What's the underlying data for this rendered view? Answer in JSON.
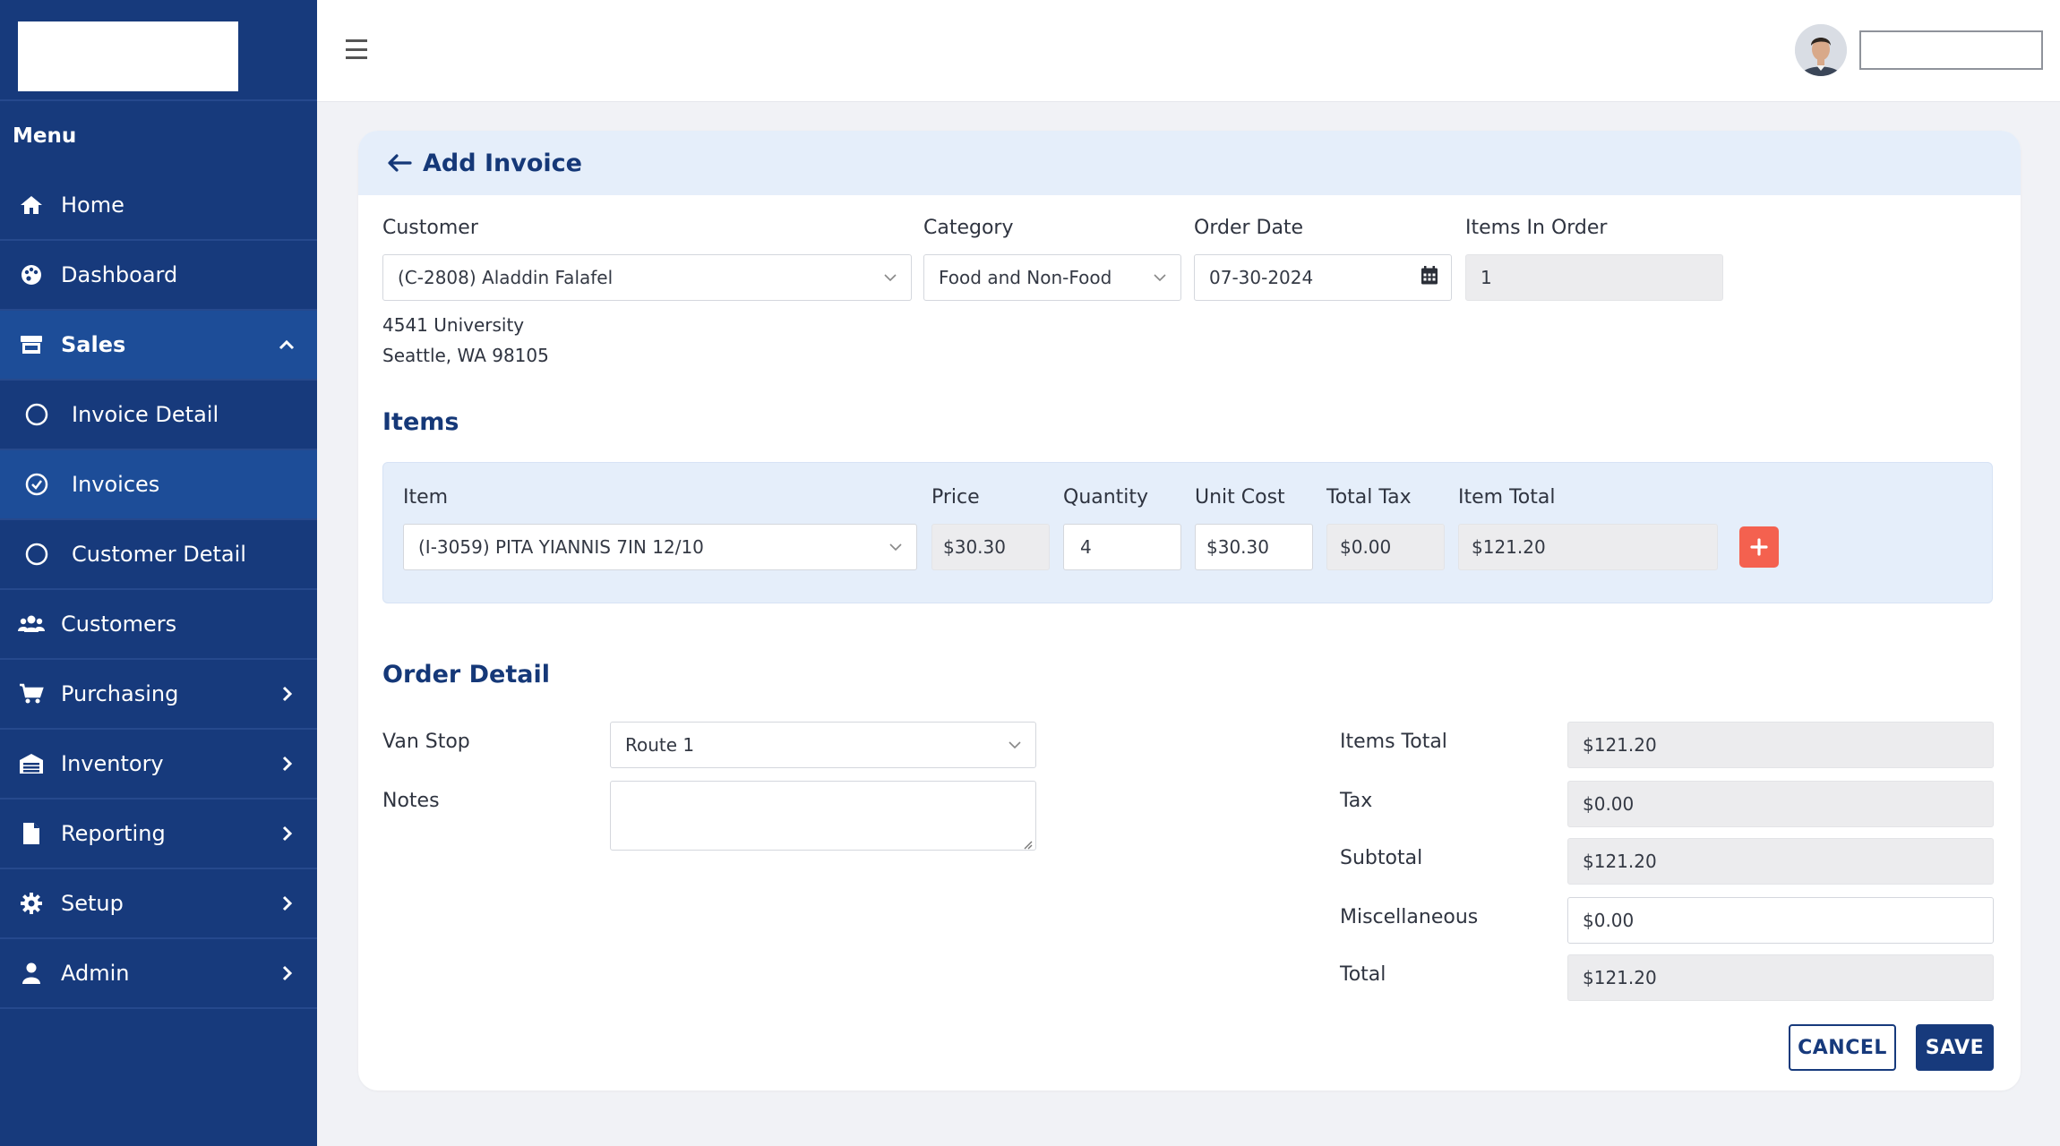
{
  "sidebar": {
    "menu_heading": "Menu",
    "items": [
      {
        "label": "Home",
        "icon": "home-icon"
      },
      {
        "label": "Dashboard",
        "icon": "palette-icon"
      },
      {
        "label": "Sales",
        "icon": "store-icon",
        "expanded": true
      },
      {
        "label": "Invoice Detail",
        "icon": "circle-icon"
      },
      {
        "label": "Invoices",
        "icon": "check-circle-icon",
        "active": true
      },
      {
        "label": "Customer Detail",
        "icon": "circle-icon"
      },
      {
        "label": "Customers",
        "icon": "users-icon"
      },
      {
        "label": "Purchasing",
        "icon": "cart-icon"
      },
      {
        "label": "Inventory",
        "icon": "warehouse-icon"
      },
      {
        "label": "Reporting",
        "icon": "file-icon"
      },
      {
        "label": "Setup",
        "icon": "gear-icon"
      },
      {
        "label": "Admin",
        "icon": "user-icon"
      }
    ]
  },
  "page": {
    "title": "Add Invoice"
  },
  "header_fields": {
    "customer_label": "Customer",
    "customer_value": "(C-2808) Aladdin Falafel",
    "category_label": "Category",
    "category_value": "Food and Non-Food",
    "order_date_label": "Order Date",
    "order_date_value": "07-30-2024",
    "items_in_order_label": "Items In Order",
    "items_in_order_value": "1",
    "address_line1": "4541 University",
    "address_line2": "Seattle, WA 98105"
  },
  "items_section": {
    "title": "Items",
    "columns": [
      "Item",
      "Price",
      "Quantity",
      "Unit Cost",
      "Total Tax",
      "Item Total"
    ],
    "row": {
      "item": "(I-3059) PITA YIANNIS 7IN 12/10",
      "price": "$30.30",
      "quantity": "4",
      "unit_cost": "$30.30",
      "total_tax": "$0.00",
      "item_total": "$121.20"
    }
  },
  "order_detail": {
    "title": "Order Detail",
    "van_stop_label": "Van Stop",
    "van_stop_value": "Route 1",
    "notes_label": "Notes",
    "items_total_label": "Items Total",
    "items_total_value": "$121.20",
    "tax_label": "Tax",
    "tax_value": "$0.00",
    "subtotal_label": "Subtotal",
    "subtotal_value": "$121.20",
    "misc_label": "Miscellaneous",
    "misc_value": "$0.00",
    "total_label": "Total",
    "total_value": "$121.20"
  },
  "actions": {
    "cancel_label": "CANCEL",
    "save_label": "SAVE"
  },
  "colors": {
    "sidebar_bg": "#173a7c",
    "accent": "#153878",
    "add_button": "#f4614f"
  }
}
